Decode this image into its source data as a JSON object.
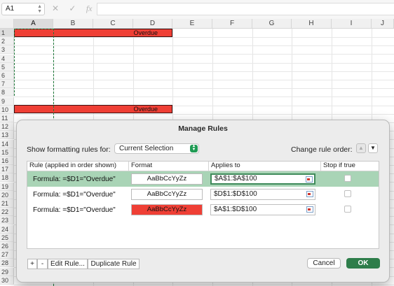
{
  "formula_bar": {
    "name_box": "A1",
    "cancel_icon": "✕",
    "confirm_icon": "✓",
    "fx_icon": "fx",
    "formula": ""
  },
  "columns": [
    "A",
    "B",
    "C",
    "D",
    "E",
    "F",
    "G",
    "H",
    "I",
    "J"
  ],
  "rows": [
    "1",
    "2",
    "3",
    "4",
    "5",
    "6",
    "7",
    "8",
    "9",
    "10",
    "11",
    "12",
    "13",
    "14",
    "15",
    "16",
    "17",
    "18",
    "19",
    "20",
    "21",
    "22",
    "23",
    "24",
    "25",
    "26",
    "27",
    "28",
    "29",
    "30"
  ],
  "cells": {
    "d1": "Overdue",
    "d10": "Overdue"
  },
  "colors": {
    "overdue_fill": "#ef3f35",
    "accent_green": "#2e7d4a",
    "selected_row": "#a9d4b6"
  },
  "dialog": {
    "title": "Manage Rules",
    "show_label": "Show formatting rules for:",
    "show_value": "Current Selection",
    "order_label": "Change rule order:",
    "headers": {
      "rule": "Rule (applied in order shown)",
      "format": "Format",
      "applies": "Applies to",
      "stop": "Stop if true"
    },
    "rules": [
      {
        "rule": "Formula: =$D1=\"Overdue\"",
        "preview": "AaBbCcYyZz",
        "applies_to": "$A$1:$A$100",
        "stop": false
      },
      {
        "rule": "Formula: =$D1=\"Overdue\"",
        "preview": "AaBbCcYyZz",
        "applies_to": "$D$1:$D$100",
        "stop": false
      },
      {
        "rule": "Formula: =$D1=\"Overdue\"",
        "preview": "AaBbCcYyZz",
        "applies_to": "$A$1:$D$100",
        "stop": false
      }
    ],
    "buttons": {
      "add": "+",
      "remove": "-",
      "edit": "Edit Rule...",
      "duplicate": "Duplicate Rule",
      "cancel": "Cancel",
      "ok": "OK"
    }
  }
}
